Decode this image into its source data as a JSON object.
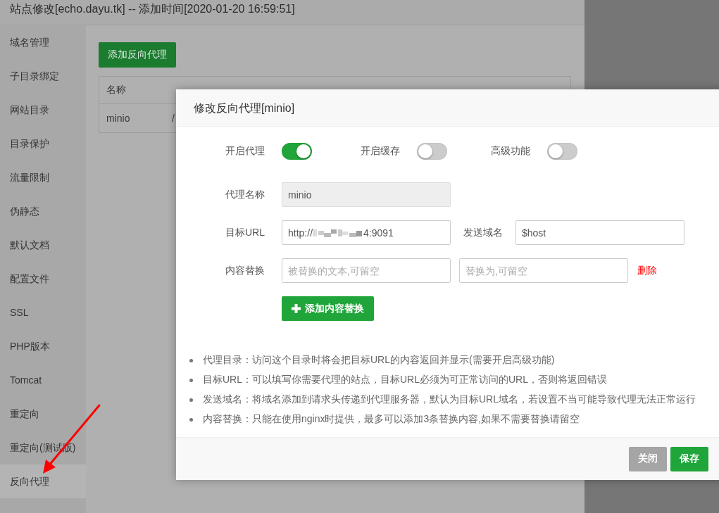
{
  "window": {
    "title": "站点修改[echo.dayu.tk] -- 添加时间[2020-01-20 16:59:51]"
  },
  "sidebar": {
    "items": [
      {
        "label": "域名管理",
        "selected": false
      },
      {
        "label": "子目录绑定",
        "selected": false
      },
      {
        "label": "网站目录",
        "selected": false
      },
      {
        "label": "目录保护",
        "selected": false
      },
      {
        "label": "流量限制",
        "selected": false
      },
      {
        "label": "伪静态",
        "selected": false
      },
      {
        "label": "默认文档",
        "selected": false
      },
      {
        "label": "配置文件",
        "selected": false
      },
      {
        "label": "SSL",
        "selected": false
      },
      {
        "label": "PHP版本",
        "selected": false
      },
      {
        "label": "Tomcat",
        "selected": false
      },
      {
        "label": "重定向",
        "selected": false
      },
      {
        "label": "重定向(测试版)",
        "selected": false
      },
      {
        "label": "反向代理",
        "selected": true
      }
    ]
  },
  "content": {
    "add_button": "添加反向代理",
    "table": {
      "columns": [
        "名称"
      ],
      "rows": [
        [
          "minio",
          "/"
        ]
      ]
    }
  },
  "modal": {
    "title": "修改反向代理[minio]",
    "switches": [
      {
        "label": "开启代理",
        "on": true
      },
      {
        "label": "开启缓存",
        "on": false
      },
      {
        "label": "高级功能",
        "on": false
      }
    ],
    "proxy_name": {
      "label": "代理名称",
      "value": "minio",
      "disabled": true
    },
    "target_url": {
      "label": "目标URL",
      "value_start": "http://",
      "value_end": "4:9091",
      "redacted": true
    },
    "send_domain": {
      "label": "发送域名",
      "value": "$host"
    },
    "replace": {
      "label": "内容替换",
      "from_placeholder": "被替换的文本,可留空",
      "to_placeholder": "替换为,可留空",
      "delete": "删除"
    },
    "add_replace_button": "添加内容替换",
    "notes": [
      "代理目录：访问这个目录时将会把目标URL的内容返回并显示(需要开启高级功能)",
      "目标URL：可以填写你需要代理的站点，目标URL必须为可正常访问的URL，否则将返回错误",
      "发送域名：将域名添加到请求头传递到代理服务器，默认为目标URL域名，若设置不当可能导致代理无法正常运行",
      "内容替换：只能在使用nginx时提供，最多可以添加3条替换内容,如果不需要替换请留空"
    ],
    "buttons": [
      {
        "label": "关闭",
        "disabled": true
      },
      {
        "label": "保存",
        "disabled": false
      }
    ]
  }
}
